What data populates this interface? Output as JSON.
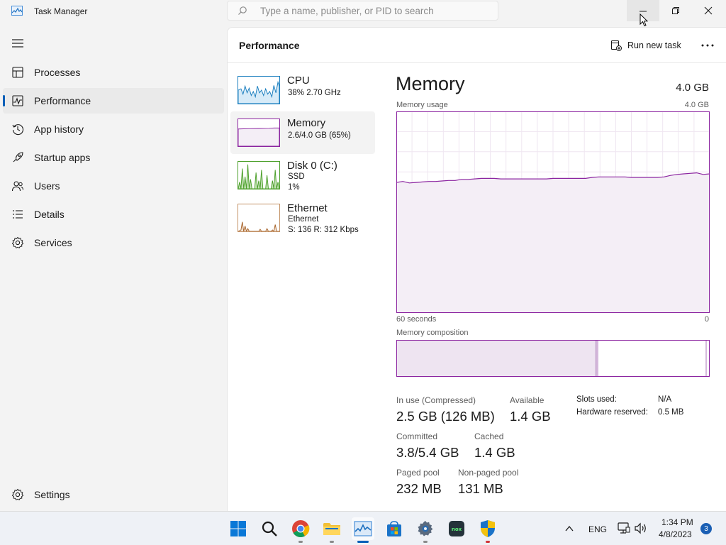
{
  "window": {
    "title": "Task Manager",
    "search_placeholder": "Type a name, publisher, or PID to search"
  },
  "sidebar": {
    "items": [
      {
        "label": "Processes",
        "icon": "processes-icon"
      },
      {
        "label": "Performance",
        "icon": "performance-icon",
        "active": true
      },
      {
        "label": "App history",
        "icon": "history-icon"
      },
      {
        "label": "Startup apps",
        "icon": "startup-icon"
      },
      {
        "label": "Users",
        "icon": "users-icon"
      },
      {
        "label": "Details",
        "icon": "details-icon"
      },
      {
        "label": "Services",
        "icon": "services-icon"
      }
    ],
    "settings_label": "Settings"
  },
  "header": {
    "title": "Performance",
    "run_task_label": "Run new task"
  },
  "resources": [
    {
      "name": "CPU",
      "lines": [
        "38% 2.70 GHz"
      ],
      "color": "#1b7fbf"
    },
    {
      "name": "Memory",
      "lines": [
        "2.6/4.0 GB (65%)"
      ],
      "color": "#8b24a0",
      "active": true
    },
    {
      "name": "Disk 0 (C:)",
      "lines": [
        "SSD",
        "1%"
      ],
      "color": "#4da02c"
    },
    {
      "name": "Ethernet",
      "lines": [
        "Ethernet",
        "S: 136 R: 312 Kbps"
      ],
      "color": "#a7632a"
    }
  ],
  "detail": {
    "title": "Memory",
    "total": "4.0 GB",
    "usage_label": "Memory usage",
    "usage_max": "4.0 GB",
    "time_left": "60 seconds",
    "time_right": "0",
    "composition_label": "Memory composition",
    "stats": {
      "in_use_label": "In use (Compressed)",
      "in_use_value": "2.5 GB (126 MB)",
      "available_label": "Available",
      "available_value": "1.4 GB",
      "committed_label": "Committed",
      "committed_value": "3.8/5.4 GB",
      "cached_label": "Cached",
      "cached_value": "1.4 GB",
      "paged_label": "Paged pool",
      "paged_value": "232 MB",
      "nonpaged_label": "Non-paged pool",
      "nonpaged_value": "131 MB",
      "slots_label": "Slots used:",
      "slots_value": "N/A",
      "hw_label": "Hardware reserved:",
      "hw_value": "0.5 MB"
    }
  },
  "chart_data": {
    "type": "area",
    "title": "Memory usage",
    "xlabel": "",
    "ylabel": "",
    "x_labels": [
      "60 seconds",
      "0"
    ],
    "ylim": [
      0,
      4.0
    ],
    "grid": true,
    "series": [
      {
        "name": "",
        "values": [
          2.59,
          2.61,
          2.58,
          2.59,
          2.6,
          2.61,
          2.61,
          2.62,
          2.63,
          2.63,
          2.65,
          2.65,
          2.66,
          2.67,
          2.67,
          2.67,
          2.66,
          2.66,
          2.66,
          2.66,
          2.66,
          2.66,
          2.66,
          2.66,
          2.67,
          2.67,
          2.67,
          2.67,
          2.67,
          2.67,
          2.69,
          2.7,
          2.7,
          2.7,
          2.7,
          2.7,
          2.69,
          2.69,
          2.69,
          2.69,
          2.69,
          2.7,
          2.73,
          2.75,
          2.76,
          2.77,
          2.78,
          2.75,
          2.76
        ],
        "color": "#8b24a0"
      }
    ]
  },
  "taskbar": {
    "icons": [
      "windows-start-icon",
      "search-icon",
      "chrome-icon",
      "file-explorer-icon",
      "task-manager-icon",
      "microsoft-store-icon",
      "settings-icon",
      "nox-icon",
      "windows-security-icon"
    ],
    "language": "ENG",
    "time": "1:34 PM",
    "date": "4/8/2023",
    "notification_count": "3"
  }
}
